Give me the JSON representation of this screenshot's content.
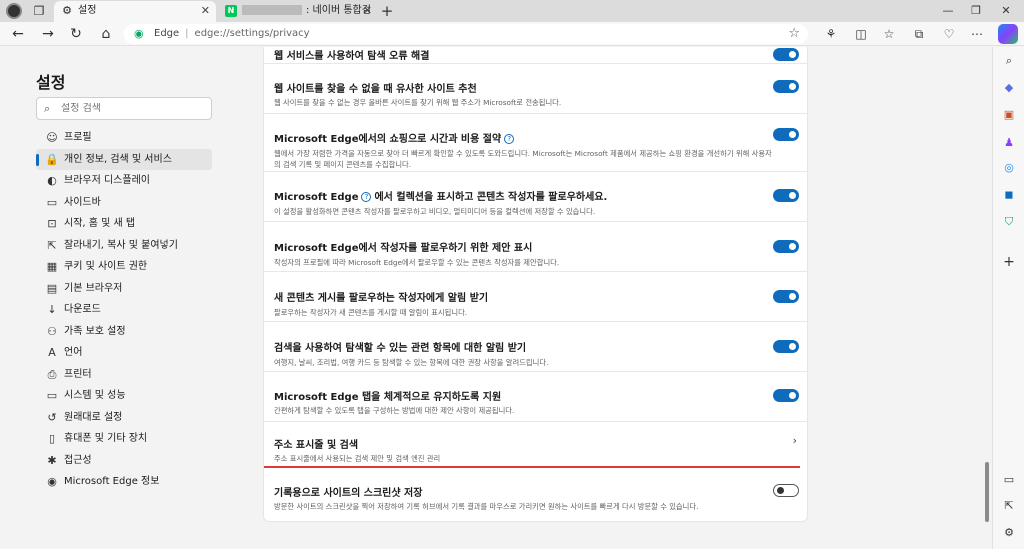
{
  "tabs": [
    {
      "label": "설정",
      "icon": "gear-icon",
      "active": true
    },
    {
      "label": ": 네이버 통합검색",
      "icon": "naver-icon",
      "active": false
    }
  ],
  "naver_logo": "N",
  "address": {
    "site": "Edge",
    "url": "edge://settings/privacy"
  },
  "sidebar": {
    "title": "설정",
    "search_placeholder": "설정 검색",
    "items": [
      {
        "label": "프로필",
        "icon": "profile-icon",
        "glyph": "☺"
      },
      {
        "label": "개인 정보, 검색 및 서비스",
        "icon": "lock-icon",
        "glyph": "🔒",
        "active": true
      },
      {
        "label": "브라우저 디스플레이",
        "icon": "palette-icon",
        "glyph": "◐"
      },
      {
        "label": "사이드바",
        "icon": "sidebar-icon",
        "glyph": "▭"
      },
      {
        "label": "시작, 홈 및 새 탭",
        "icon": "home-tabs-icon",
        "glyph": "⊡"
      },
      {
        "label": "잘라내기, 복사 및 붙여넣기",
        "icon": "share-icon",
        "glyph": "⇱"
      },
      {
        "label": "쿠키 및 사이트 권한",
        "icon": "cookie-icon",
        "glyph": "▦"
      },
      {
        "label": "기본 브라우저",
        "icon": "browser-icon",
        "glyph": "▤"
      },
      {
        "label": "다운로드",
        "icon": "download-icon",
        "glyph": "↓"
      },
      {
        "label": "가족 보호 설정",
        "icon": "family-icon",
        "glyph": "⚇"
      },
      {
        "label": "언어",
        "icon": "language-icon",
        "glyph": "A"
      },
      {
        "label": "프린터",
        "icon": "printer-icon",
        "glyph": "⎙"
      },
      {
        "label": "시스템 및 성능",
        "icon": "system-icon",
        "glyph": "▭"
      },
      {
        "label": "원래대로 설정",
        "icon": "reset-icon",
        "glyph": "↺"
      },
      {
        "label": "휴대폰 및 기타 장치",
        "icon": "phone-icon",
        "glyph": "▯"
      },
      {
        "label": "접근성",
        "icon": "accessibility-icon",
        "glyph": "✱"
      },
      {
        "label": "Microsoft Edge 정보",
        "icon": "edge-icon",
        "glyph": "◉"
      }
    ]
  },
  "settings": [
    {
      "title": "웹 서비스를 사용하여 탐색 오류 해결",
      "desc": "",
      "toggle": true
    },
    {
      "title": "웹 사이트를 찾을 수 없을 때 유사한 사이트 추천",
      "desc": "웹 사이트를 찾을 수 없는 경우 올바른 사이트를 찾기 위해 웹 주소가 Microsoft로 전송됩니다.",
      "toggle": true
    },
    {
      "title": "Microsoft Edge에서의 쇼핑으로 시간과 비용 절약",
      "help": true,
      "desc": "웹에서 가장 저렴한 가격을 자동으로 찾아 더 빠르게 확인할 수 있도록 도와드립니다. Microsoft는 Microsoft 제품에서 제공하는 쇼핑 환경을 개선하기 위해 사용자의 검색 기록 및 페이지 콘텐츠를 수집합니다.",
      "toggle": true
    },
    {
      "title_a": "Microsoft Edge",
      "title_b": "에서 컬렉션을 표시하고 콘텐츠 작성자를 팔로우하세요.",
      "desc": "이 설정을 활성화하면 콘텐츠 작성자를 팔로우하고 비디오, 멀티미디어 등을 컬렉션에 저장할 수 있습니다.",
      "toggle": true
    },
    {
      "title": "Microsoft Edge에서 작성자를 팔로우하기 위한 제안 표시",
      "desc": "작성자의 프로필에 따라 Microsoft Edge에서 팔로우할 수 있는 콘텐츠 작성자를 제안합니다.",
      "toggle": true
    },
    {
      "title": "새 콘텐츠 게시를 팔로우하는 작성자에게 알림 받기",
      "desc": "팔로우하는 작성자가 새 콘텐츠를 게시할 때 알림이 표시됩니다.",
      "toggle": true
    },
    {
      "title": "검색을 사용하여 탐색할 수 있는 관련 항목에 대한 알림 받기",
      "desc": "여행지, 날씨, 조리법, 여행 카드 등 탐색할 수 있는 항목에 대한 권장 사항을 알려드립니다.",
      "toggle": true
    },
    {
      "title": "Microsoft Edge 탭을 체계적으로 유지하도록 지원",
      "desc": "간편하게 탐색할 수 있도록 탭을 구성하는 방법에 대한 제안 사항이 제공됩니다.",
      "toggle": true
    },
    {
      "title": "주소 표시줄 및 검색",
      "desc": "주소 표시줄에서 사용되는 검색 제안 및 검색 엔진 관리",
      "link": true
    },
    {
      "title": "기록용으로 사이트의 스크린샷 저장",
      "desc": "방문한 사이트의 스크린샷을 찍어 저장하여 기록 허브에서 기록 결과를 마우스로 가리키면 원하는 사이트를 빠르게 다시 방문할 수 있습니다.",
      "toggle": false
    }
  ],
  "colors": {
    "accent": "#0f6cbd",
    "highlight": "#e03a3a"
  }
}
